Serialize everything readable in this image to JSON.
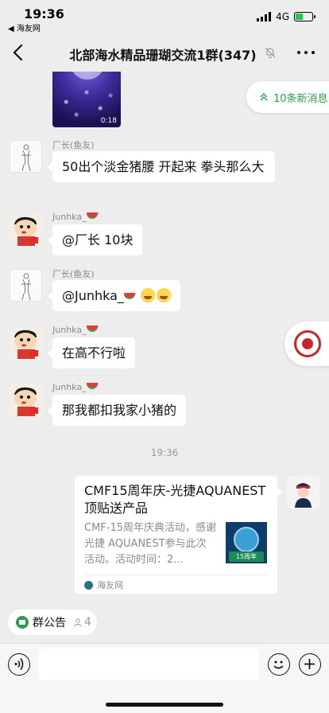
{
  "status_bar": {
    "time": "19:36",
    "back_app": "◀ 海友网",
    "network": "4G"
  },
  "nav": {
    "title": "北部海水精品珊瑚交流1群(347)"
  },
  "chat": {
    "video": {
      "duration": "0:18"
    },
    "new_messages": "10条新消息",
    "messages": [
      {
        "sender": "厂长(鱼友)",
        "text": "50出个淡金猪腰 开起来 拳头那么大"
      },
      {
        "sender": "Junhka_",
        "text": "@厂长 10块"
      },
      {
        "sender": "厂长(鱼友)",
        "text": "@Junhka_"
      },
      {
        "sender": "Junhka_",
        "text": "在高不行啦"
      },
      {
        "sender": "Junhka_",
        "text": "那我都扣我家小猪的"
      }
    ],
    "time_divider": "19:36",
    "link_card": {
      "title": "CMF15周年庆-光捷AQUANEST顶贴送产品",
      "description": "CMF-15周年庆典活动，感谢光捷 AQUANEST参与此次活动。活动时间：2...",
      "thumb_label": "15周年",
      "source": "海友网"
    }
  },
  "announcement": {
    "label": "群公告",
    "count": "4"
  },
  "colors": {
    "accent_green": "#2c9e4b",
    "background": "#ededed",
    "bubble": "#ffffff"
  }
}
